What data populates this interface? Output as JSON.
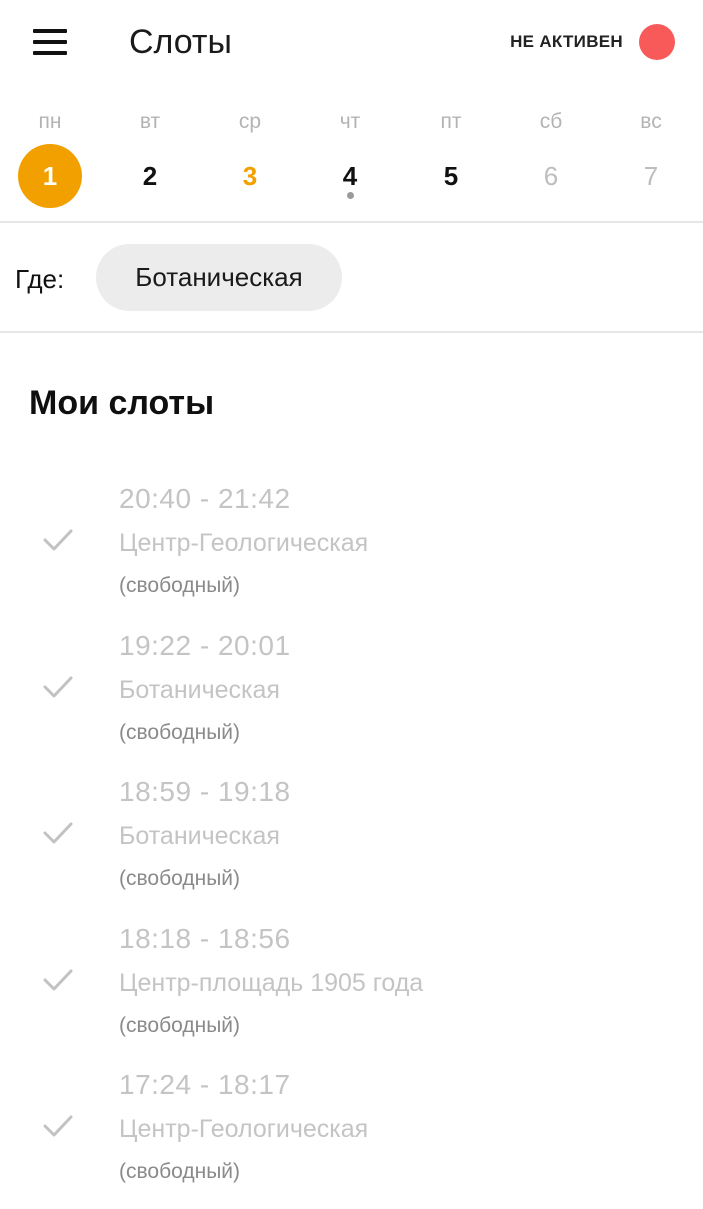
{
  "header": {
    "title": "Слоты",
    "status_label": "НЕ АКТИВЕН",
    "status_color": "#f85a5a",
    "menu_icon": "hamburger-menu-icon"
  },
  "week": {
    "days": [
      {
        "name": "пн",
        "number": "1",
        "state": "selected"
      },
      {
        "name": "вт",
        "number": "2",
        "state": "normal"
      },
      {
        "name": "ср",
        "number": "3",
        "state": "today"
      },
      {
        "name": "чт",
        "number": "4",
        "state": "normal",
        "has_dot": true
      },
      {
        "name": "пт",
        "number": "5",
        "state": "normal"
      },
      {
        "name": "сб",
        "number": "6",
        "state": "disabled"
      },
      {
        "name": "вс",
        "number": "7",
        "state": "disabled"
      }
    ],
    "accent_color": "#f2a000"
  },
  "where": {
    "label": "Где:",
    "value": "Ботаническая"
  },
  "my_slots": {
    "title": "Мои слоты",
    "items": [
      {
        "time": "20:40 - 21:42",
        "place": "Центр-Геологическая",
        "state": "(свободный)",
        "icon": "checkmark-icon"
      },
      {
        "time": "19:22 - 20:01",
        "place": "Ботаническая",
        "state": "(свободный)",
        "icon": "checkmark-icon"
      },
      {
        "time": "18:59 - 19:18",
        "place": "Ботаническая",
        "state": "(свободный)",
        "icon": "checkmark-icon"
      },
      {
        "time": "18:18 - 18:56",
        "place": "Центр-площадь 1905 года",
        "state": "(свободный)",
        "icon": "checkmark-icon"
      },
      {
        "time": "17:24 - 18:17",
        "place": "Центр-Геологическая",
        "state": "(свободный)",
        "icon": "checkmark-icon"
      }
    ]
  }
}
